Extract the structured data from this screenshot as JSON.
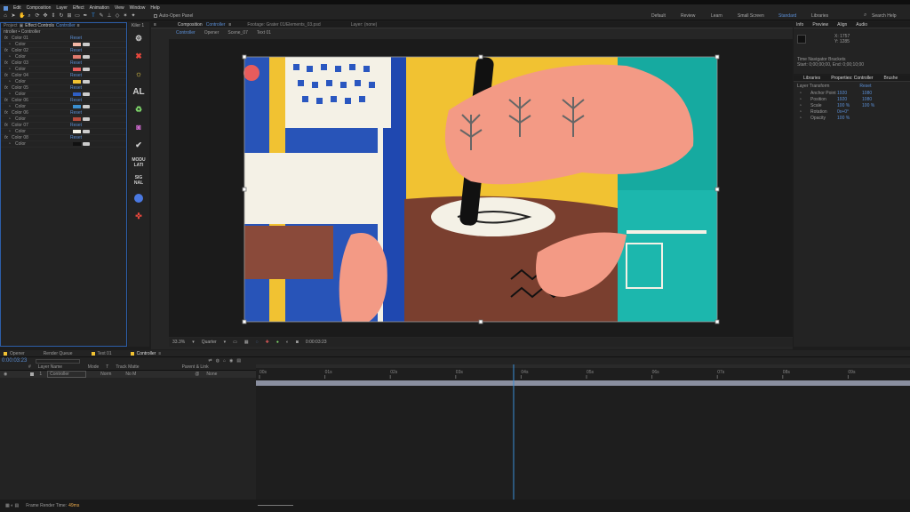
{
  "menu": [
    "Edit",
    "Composition",
    "Layer",
    "Effect",
    "Animation",
    "View",
    "Window",
    "Help"
  ],
  "toolbar": {
    "auto_open": "Auto-Open Panel"
  },
  "workspaces": [
    "Default",
    "Review",
    "Learn",
    "Small Screen",
    "Standard",
    "Libraries"
  ],
  "search_help": "Search Help",
  "effect_controls": {
    "project_tab": "Project",
    "tab_label": "Effect Controls",
    "tab_target": "Controller",
    "path": "ntroller • Controller",
    "rows": [
      {
        "label": "Color 01",
        "type": "group",
        "value": "Reset"
      },
      {
        "label": "Color",
        "type": "color",
        "color": "#f2b7a5"
      },
      {
        "label": "Color 02",
        "type": "group",
        "value": "Reset"
      },
      {
        "label": "Color",
        "type": "color",
        "color": "#e07a6e"
      },
      {
        "label": "Color 03",
        "type": "group",
        "value": "Reset"
      },
      {
        "label": "Color",
        "type": "color",
        "color": "#e85c5c"
      },
      {
        "label": "Color 04",
        "type": "group",
        "value": "Reset"
      },
      {
        "label": "Color",
        "type": "color",
        "color": "#f1c232"
      },
      {
        "label": "Color 05",
        "type": "group",
        "value": "Reset"
      },
      {
        "label": "Color",
        "type": "color",
        "color": "#2f5fc4"
      },
      {
        "label": "Color 06",
        "type": "group",
        "value": "Reset"
      },
      {
        "label": "Color",
        "type": "color",
        "color": "#3a8fd0"
      },
      {
        "label": "Color 06",
        "type": "group",
        "value": "Reset"
      },
      {
        "label": "Color",
        "type": "color",
        "color": "#b84b3d"
      },
      {
        "label": "Color 07",
        "type": "group",
        "value": "Reset"
      },
      {
        "label": "Color",
        "type": "color",
        "color": "#f4f1e6"
      },
      {
        "label": "Color 08",
        "type": "group",
        "value": "Reset"
      },
      {
        "label": "Color",
        "type": "color",
        "color": "#111111"
      }
    ]
  },
  "script_panel": {
    "title": "Kiler 1",
    "text_buttons": [
      "AL",
      "MODU LATI",
      "SIG NAL"
    ]
  },
  "composition": {
    "tab_label": "Composition",
    "tab_target": "Controller",
    "footage_tab": "Footage: Grater 01/Elements_03.psd",
    "layer_tab": "Layer: (none)",
    "sub_tabs": [
      "Controller",
      "Opener",
      "Scene_07",
      "Text 01"
    ],
    "zoom": "33.3%",
    "quality": "Quarter",
    "timecode": "0:00:03:23"
  },
  "info": {
    "tabs": [
      "Info",
      "Preview",
      "Align",
      "Audio"
    ],
    "x": "X: 1757",
    "y": "Y: 1285",
    "brackets": "Time Navigator Brackets",
    "range": "Start: 0;00;00;00, End: 0;00;10;00"
  },
  "properties": {
    "tabs": [
      "Libraries",
      "Properties: Controller",
      "Brushe"
    ],
    "section": "Layer Transform",
    "reset": "Reset",
    "rows": [
      {
        "name": "Anchor Point",
        "v1": "1920",
        "v2": "1080"
      },
      {
        "name": "Position",
        "v1": "1920",
        "v2": "1080"
      },
      {
        "name": "Scale",
        "v1": "100 %",
        "v2": "100 %"
      },
      {
        "name": "Rotation",
        "v1": "0x+0°",
        "v2": ""
      },
      {
        "name": "Opacity",
        "v1": "100 %",
        "v2": ""
      }
    ]
  },
  "timeline": {
    "tabs": [
      "Opener",
      "Render Queue",
      "Text 01",
      "Controller"
    ],
    "current_time": "0:00:03:23",
    "headers": [
      "#",
      "Layer Name",
      "Mode",
      "T",
      "Track Matte",
      "Parent & Link"
    ],
    "layer": {
      "num": "1",
      "name": "Controller",
      "mode": "Norm",
      "matte": "No M",
      "parent": "None"
    },
    "ruler": [
      "00s",
      "01s",
      "02s",
      "03s",
      "04s",
      "05s",
      "06s",
      "07s",
      "08s",
      "09s"
    ],
    "playhead_fraction": 0.394
  },
  "status": {
    "label": "Frame Render Time:",
    "value": "49ms"
  },
  "colors": {
    "accent": "#2d8ceb",
    "panel": "#232323",
    "link": "#5b8fd6"
  }
}
